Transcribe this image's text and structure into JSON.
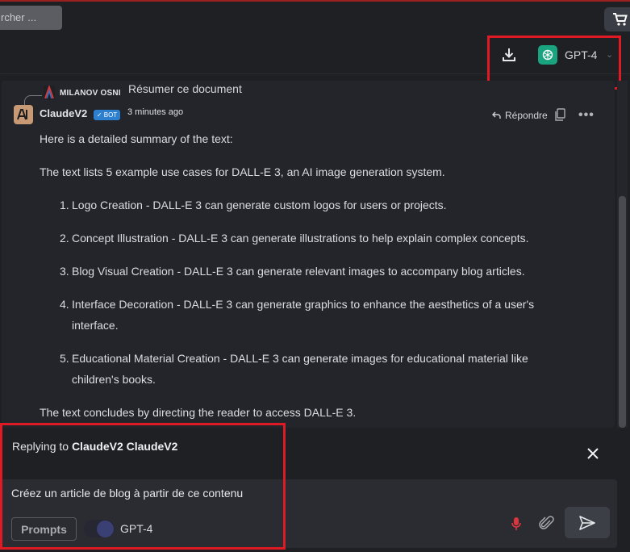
{
  "topbar": {
    "search_text": "rcher ...",
    "cart_icon": "cart-icon"
  },
  "header": {
    "download_icon": "download-icon",
    "model": {
      "label": "GPT-4",
      "logo_icon": "openai-icon"
    }
  },
  "quoted": {
    "author": "MILANOV OSNI",
    "text": "Résumer ce document"
  },
  "message": {
    "author": "ClaudeV2",
    "badge": "✓ BOT",
    "time": "3 minutes ago",
    "reply_label": "Répondre",
    "intro": "Here is a detailed summary of the text:",
    "lead": "The text lists 5 example use cases for DALL-E 3, an AI image generation system.",
    "items": [
      {
        "num": "1.",
        "text": "Logo Creation - DALL-E 3 can generate custom logos for users or projects."
      },
      {
        "num": "2.",
        "text": "Concept Illustration - DALL-E 3 can generate illustrations to help explain complex concepts."
      },
      {
        "num": "3.",
        "text": "Blog Visual Creation - DALL-E 3 can generate relevant images to accompany blog articles."
      },
      {
        "num": "4.",
        "text": "Interface Decoration - DALL-E 3 can generate graphics to enhance the aesthetics of a user's interface."
      },
      {
        "num": "5.",
        "text": "Educational Material Creation - DALL-E 3 can generate images for educational material like children's books."
      }
    ],
    "conclusion": "The text concludes by directing the reader to access DALL-E 3."
  },
  "reply": {
    "prefix": "Replying to ",
    "target": "ClaudeV2 ClaudeV2",
    "input_value": "Créez un article de blog à partir de ce contenu",
    "prompts_label": "Prompts",
    "model_toggle_label": "GPT-4"
  },
  "colors": {
    "highlight": "#e01a24",
    "accent_green": "#19a37f",
    "bot_badge": "#2d7fd0"
  }
}
